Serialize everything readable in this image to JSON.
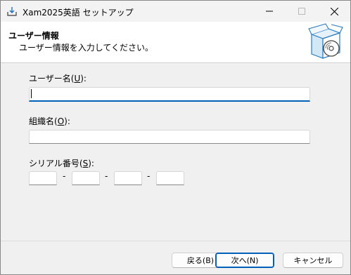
{
  "window": {
    "title": "Xam2025英語 セットアップ"
  },
  "banner": {
    "title": "ユーザー情報",
    "subtitle": "ユーザー情報を入力してください。"
  },
  "form": {
    "username": {
      "label_pre": "ユーザー名(",
      "mnemonic": "U",
      "label_post": "):",
      "value": ""
    },
    "organization": {
      "label_pre": "組織名(",
      "mnemonic": "O",
      "label_post": "):",
      "value": ""
    },
    "serial": {
      "label_pre": "シリアル番号(",
      "mnemonic": "S",
      "label_post": "):",
      "separator": "-",
      "parts": [
        "",
        "",
        "",
        ""
      ]
    }
  },
  "buttons": {
    "back": "戻る(B)",
    "next": "次へ(N)",
    "cancel": "キャンセル"
  },
  "colors": {
    "accent": "#005fb8"
  },
  "icons": {
    "app": "installer-icon",
    "banner": "software-box-icon"
  }
}
